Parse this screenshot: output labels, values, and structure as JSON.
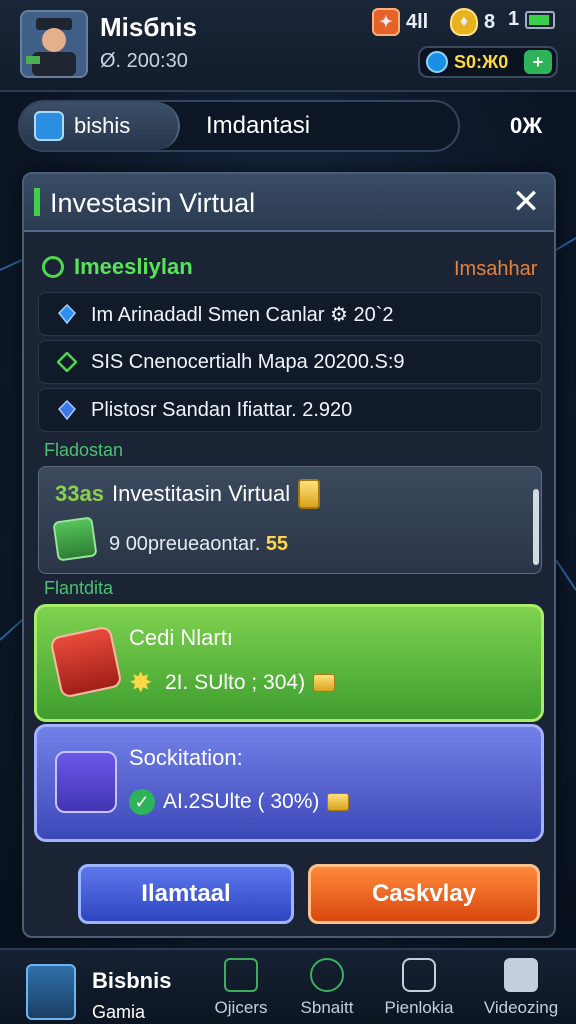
{
  "player": {
    "name": "Misбnis",
    "sub": "Ø. 200:30"
  },
  "stats": {
    "signal": "4ll",
    "shield_count": "8",
    "battery_level": "1"
  },
  "currency": {
    "value": "S0:Ж0",
    "icon": "coin-icon"
  },
  "tabs": {
    "active": "bishis",
    "second": "Imdantasi",
    "percent": "0Ж"
  },
  "modal": {
    "title": "Investasin Virtual",
    "section_label": "Imeesliylan",
    "section_link": "Imsahhar",
    "rows": [
      "Im Arinadadl Smen Canlar ⚙ 20`2",
      "SIS Cnenocertialh Mapa 20200.S:9",
      "Plistosr Sandan Ifiattar. 2.920"
    ],
    "label_1": "Fladostan",
    "invest_card": {
      "prefix": "33as",
      "title": "Investitasin Virtual",
      "line_prefix": "9",
      "line_text": "00preueaontar.",
      "line_value": "55"
    },
    "label_2": "Flantdita",
    "offers": [
      {
        "title": "Cedi Nlartı",
        "detail": "2I. SUlto ; 304)"
      },
      {
        "title": "Sockitation:",
        "detail": "AI.2SUlte ( 30%)"
      }
    ],
    "buttons": {
      "left": "Ilamtaal",
      "right": "Caskvlay"
    }
  },
  "bottom_nav": [
    {
      "title": "Bisbnis",
      "sub": "Gamia"
    },
    {
      "label": "Ojicers"
    },
    {
      "label": "Sbnaitt"
    },
    {
      "label": "Pienlokia"
    },
    {
      "label": "Videozing"
    }
  ],
  "colors": {
    "accent_green": "#4fd64f",
    "accent_orange": "#e7823a",
    "gold": "#ffd84a"
  }
}
